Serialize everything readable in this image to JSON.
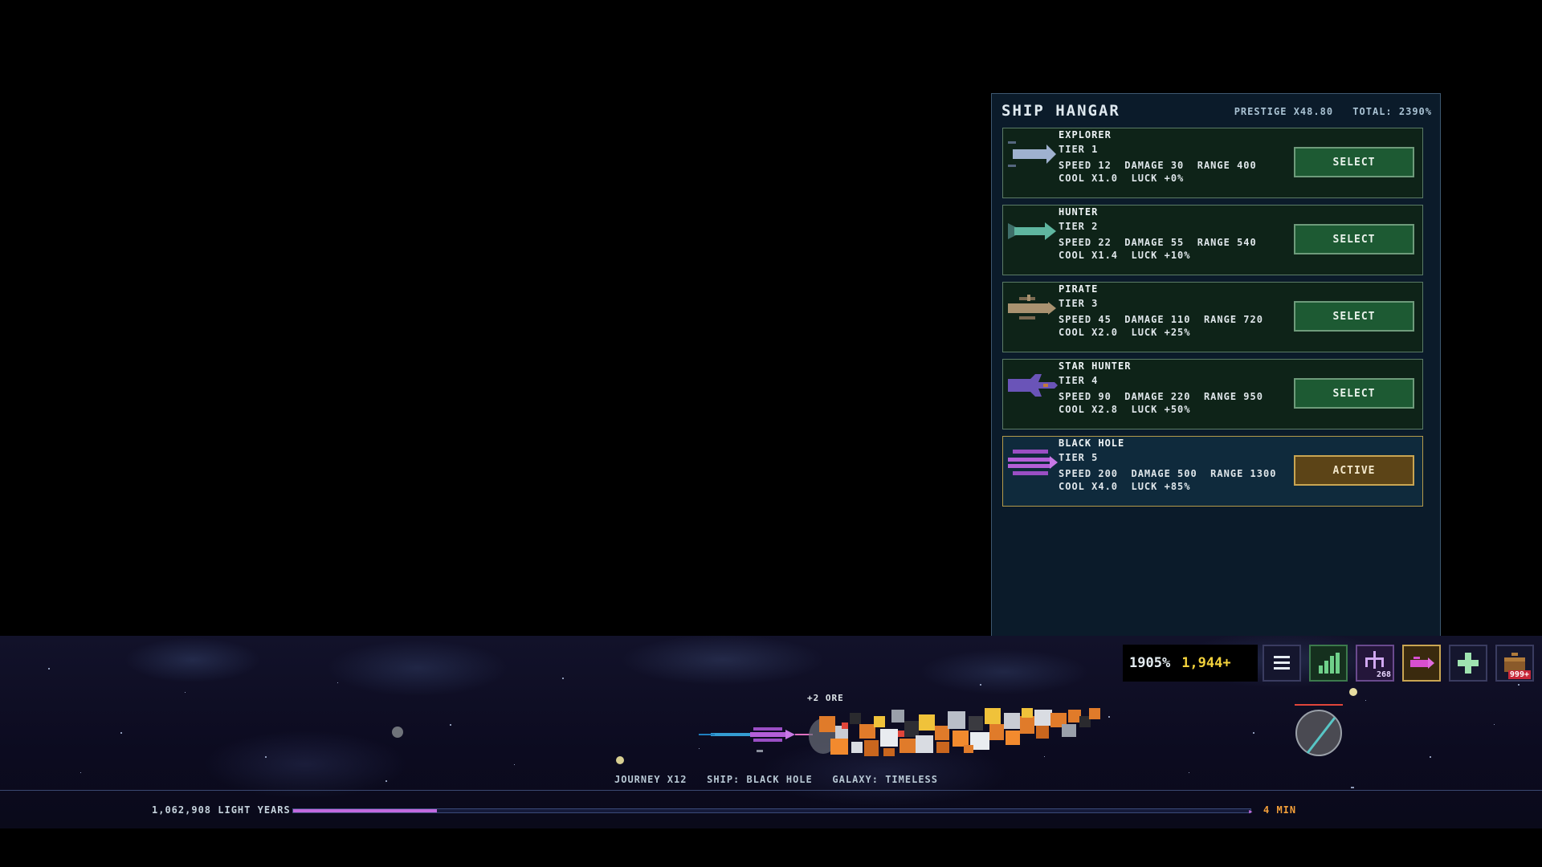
{
  "hangar": {
    "title": "SHIP HANGAR",
    "prestige": "PRESTIGE X48.80",
    "total": "TOTAL: 2390%",
    "ships": [
      {
        "name": "EXPLORER",
        "tier": "TIER 1",
        "stats1": "SPEED 12  DAMAGE 30  RANGE 400",
        "stats2": "COOL X1.0  LUCK +0%",
        "button": "SELECT",
        "color": "#9fb1cf",
        "icon": "explorer-ship-icon"
      },
      {
        "name": "HUNTER",
        "tier": "TIER 2",
        "stats1": "SPEED 22  DAMAGE 55  RANGE 540",
        "stats2": "COOL X1.4  LUCK +10%",
        "button": "SELECT",
        "color": "#5fb6a0",
        "icon": "hunter-ship-icon"
      },
      {
        "name": "PIRATE",
        "tier": "TIER 3",
        "stats1": "SPEED 45  DAMAGE 110  RANGE 720",
        "stats2": "COOL X2.0  LUCK +25%",
        "button": "SELECT",
        "color": "#a99270",
        "icon": "pirate-ship-icon"
      },
      {
        "name": "STAR HUNTER",
        "tier": "TIER 4",
        "stats1": "SPEED 90  DAMAGE 220  RANGE 950",
        "stats2": "COOL X2.8  LUCK +50%",
        "button": "SELECT",
        "color": "#6a54b8",
        "icon": "star-hunter-ship-icon"
      },
      {
        "name": "BLACK HOLE",
        "tier": "TIER 5",
        "stats1": "SPEED 200  DAMAGE 500  RANGE 1300",
        "stats2": "COOL X4.0  LUCK +85%",
        "button": "ACTIVE",
        "color": "#9a4ec4",
        "icon": "black-hole-ship-icon"
      }
    ]
  },
  "hud": {
    "percent": "1905%",
    "ore": "1,944+",
    "buttons": [
      {
        "icon": "menu-icon",
        "badge": ""
      },
      {
        "icon": "stats-chart-icon",
        "badge": ""
      },
      {
        "icon": "upgrade-tree-icon",
        "badge": "268"
      },
      {
        "icon": "ship-hangar-icon",
        "badge": ""
      },
      {
        "icon": "crew-plus-icon",
        "badge": ""
      },
      {
        "icon": "cargo-chest-icon",
        "badge": "999+"
      }
    ]
  },
  "journey": {
    "ore_popup": "+2 ORE",
    "info": "JOURNEY X12   SHIP: BLACK HOLE   GALAXY: TIMELESS",
    "distance": "1,062,908 LIGHT YEARS",
    "progress": 0.15,
    "eta": "4 MIN"
  },
  "colors": {
    "progress": "#c26ae0",
    "ore": "#f3d23c",
    "active": "#c9a552"
  }
}
